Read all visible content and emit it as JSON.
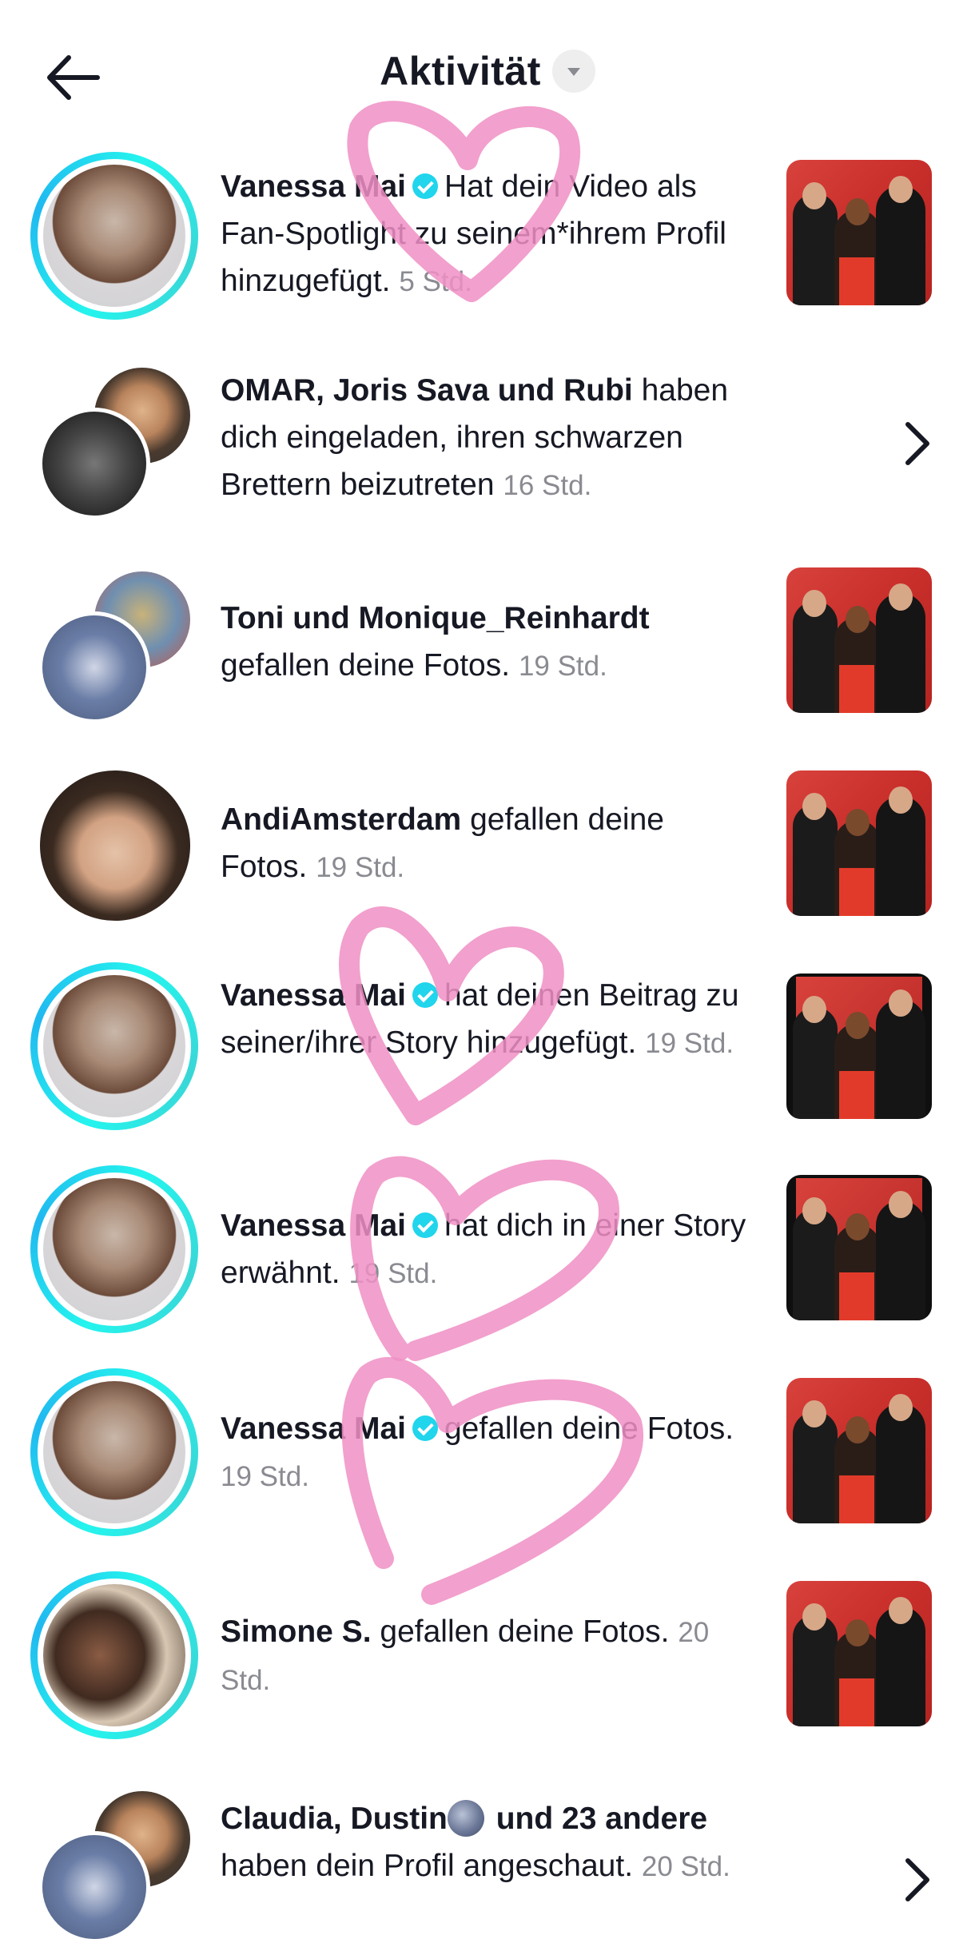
{
  "header": {
    "title": "Aktivität",
    "back_icon": "arrow-left-icon",
    "dropdown_icon": "chevron-down-icon"
  },
  "notifications": [
    {
      "name": "Vanessa Mai",
      "verified": true,
      "message": "Hat dein Video als Fan-Spotlight zu seinem*ihrem Profil hinzugefügt.",
      "time": "5 Std.",
      "trailing": "thumbnail"
    },
    {
      "name": "OMAR, Joris Sava und Rubi",
      "verified": false,
      "message": "haben dich eingeladen, ihren schwarzen Brettern beizutreten",
      "time": "16 Std.",
      "trailing": "chevron"
    },
    {
      "name": "Toni und Monique_Reinhardt",
      "verified": false,
      "message": "gefallen deine Fotos.",
      "time": "19 Std.",
      "trailing": "thumbnail"
    },
    {
      "name": "AndiAmsterdam",
      "verified": false,
      "message": "gefallen deine Fotos.",
      "time": "19 Std.",
      "trailing": "thumbnail"
    },
    {
      "name": "Vanessa Mai",
      "verified": true,
      "message": "hat deinen Beitrag zu seiner/ihrer Story hinzugefügt.",
      "time": "19 Std.",
      "trailing": "thumbnail-dark"
    },
    {
      "name": "Vanessa Mai",
      "verified": true,
      "message": "hat dich in einer Story erwähnt.",
      "time": "19 Std.",
      "trailing": "thumbnail-dark"
    },
    {
      "name": "Vanessa Mai",
      "verified": true,
      "message": "gefallen deine Fotos.",
      "time": "19 Std.",
      "trailing": "thumbnail"
    },
    {
      "name": "Simone S.",
      "verified": false,
      "message": "gefallen deine Fotos.",
      "time": "20 Std.",
      "trailing": "thumbnail"
    },
    {
      "name": "Claudia, Dustin",
      "name_suffix": "und 23 andere",
      "verified": false,
      "message": "haben dein Profil angeschaut.",
      "time": "20 Std.",
      "trailing": "chevron",
      "emoji": "new-moon-face-emoji"
    }
  ],
  "colors": {
    "story_ring": "#25f4ee",
    "verified_badge": "#20d5ec",
    "timestamp": "#8a8b91",
    "heart_overlay": "#f08fc4"
  }
}
